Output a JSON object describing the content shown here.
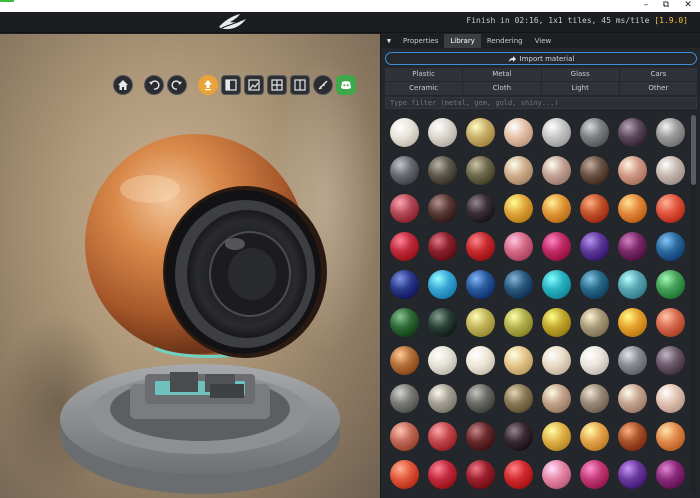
{
  "window": {
    "controls": [
      {
        "id": "minimize",
        "glyph": "–"
      },
      {
        "id": "maximize",
        "glyph": "⧉"
      },
      {
        "id": "close",
        "glyph": "✕"
      }
    ]
  },
  "header": {
    "status_text": "Finish in 02:16, 1x1 tiles, 45 ms/tile",
    "version": "[1.9.0]",
    "logo_icon": "feather-logo-icon"
  },
  "toolbar": {
    "buttons": [
      {
        "name": "home-icon"
      },
      {
        "name": "undo-icon"
      },
      {
        "name": "redo-icon"
      },
      {
        "name": "upload-icon",
        "active": true
      },
      {
        "name": "sidebar-layout-icon"
      },
      {
        "name": "image-render-icon"
      },
      {
        "name": "grid-view-icon"
      },
      {
        "name": "split-view-icon"
      },
      {
        "name": "ruler-icon"
      },
      {
        "name": "discord-icon"
      }
    ],
    "accent_color": "#e8a33a",
    "discord_color": "#3fa84a"
  },
  "panel": {
    "tabs": [
      {
        "label": "Properties"
      },
      {
        "label": "Library",
        "active": true
      },
      {
        "label": "Rendering"
      },
      {
        "label": "View"
      }
    ],
    "import_label": "Import material",
    "categories": [
      "Plastic",
      "Metal",
      "Glass",
      "Cars",
      "Ceramic",
      "Cloth",
      "Light",
      "Other"
    ],
    "filter_placeholder": "Type filter (metal, gem, gold, shiny...)",
    "swatch_colors": [
      "#e9e4da",
      "#dcd6cf",
      "#c9ae6a",
      "#e4c1a8",
      "#c6c6c6",
      "#7e7f83",
      "#5b4b5c",
      "#9a9a9a",
      "#6a6a72",
      "#5f5a4e",
      "#6f6a4e",
      "#cfae8e",
      "#c4a496",
      "#6a5244",
      "#d29a86",
      "#c6b8b0",
      "#b44a58",
      "#5a3a34",
      "#3a2e34",
      "#e0a63a",
      "#e3973a",
      "#c4542a",
      "#e5883a",
      "#e0553e",
      "#c02a3e",
      "#8a1f2c",
      "#c52a2e",
      "#d46a86",
      "#c02a66",
      "#5e3a9a",
      "#7a2a6a",
      "#2a6a9e",
      "#2a3a8a",
      "#3aa6d6",
      "#2a5a9e",
      "#2a5a7e",
      "#2ab2c2",
      "#2a6a8a",
      "#5aa6b2",
      "#46a05a",
      "#2e6a38",
      "#2a4238",
      "#c2b45a",
      "#b2b04e",
      "#c2a82e",
      "#a89a7a",
      "#e6a22e",
      "#d66a4e",
      "#b2703a",
      "#e6e2d6",
      "#f0e8d8",
      "#e6c68a",
      "#eadcc6",
      "#eae4dc",
      "#8a8a92",
      "#6a5a6a",
      "#7a7a76",
      "#a4a096",
      "#6a6a66",
      "#8a7a5a",
      "#c2a28a",
      "#9a8a7a",
      "#c6a492",
      "#e2c2b2",
      "#c26a58",
      "#c24a4e",
      "#6a2a2e",
      "#3a2a32",
      "#e2b24a",
      "#e6a44e",
      "#a8542a",
      "#e28a4e",
      "#e2573a",
      "#c22a3e",
      "#9a1f2e",
      "#d22a2e",
      "#e686a6",
      "#c23a76",
      "#6a3a9e",
      "#8a2a7a"
    ]
  }
}
